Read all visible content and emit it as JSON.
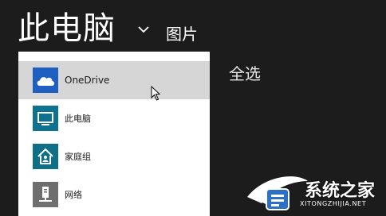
{
  "header": {
    "title": "此电脑",
    "location": "图片",
    "chevron_icon": "chevron-down-icon"
  },
  "actions": {
    "select_all": "全选"
  },
  "location_menu": {
    "items": [
      {
        "label": "OneDrive",
        "icon": "onedrive-cloud-icon",
        "color": "#1f5fbf",
        "state": "hover"
      },
      {
        "label": "此电脑",
        "icon": "computer-monitor-icon",
        "color": "#0f7290"
      },
      {
        "label": "家庭组",
        "icon": "homegroup-icon",
        "color": "#0f6f86"
      },
      {
        "label": "网络",
        "icon": "network-icon",
        "color": "#6e6e6e"
      }
    ]
  },
  "watermark": {
    "name": "系统之家",
    "url": "XITONGZHIJIA.NET"
  },
  "colors": {
    "background": "#1c1c1c",
    "menu_background": "#ffffff",
    "hover_background": "#d6d6d6"
  }
}
